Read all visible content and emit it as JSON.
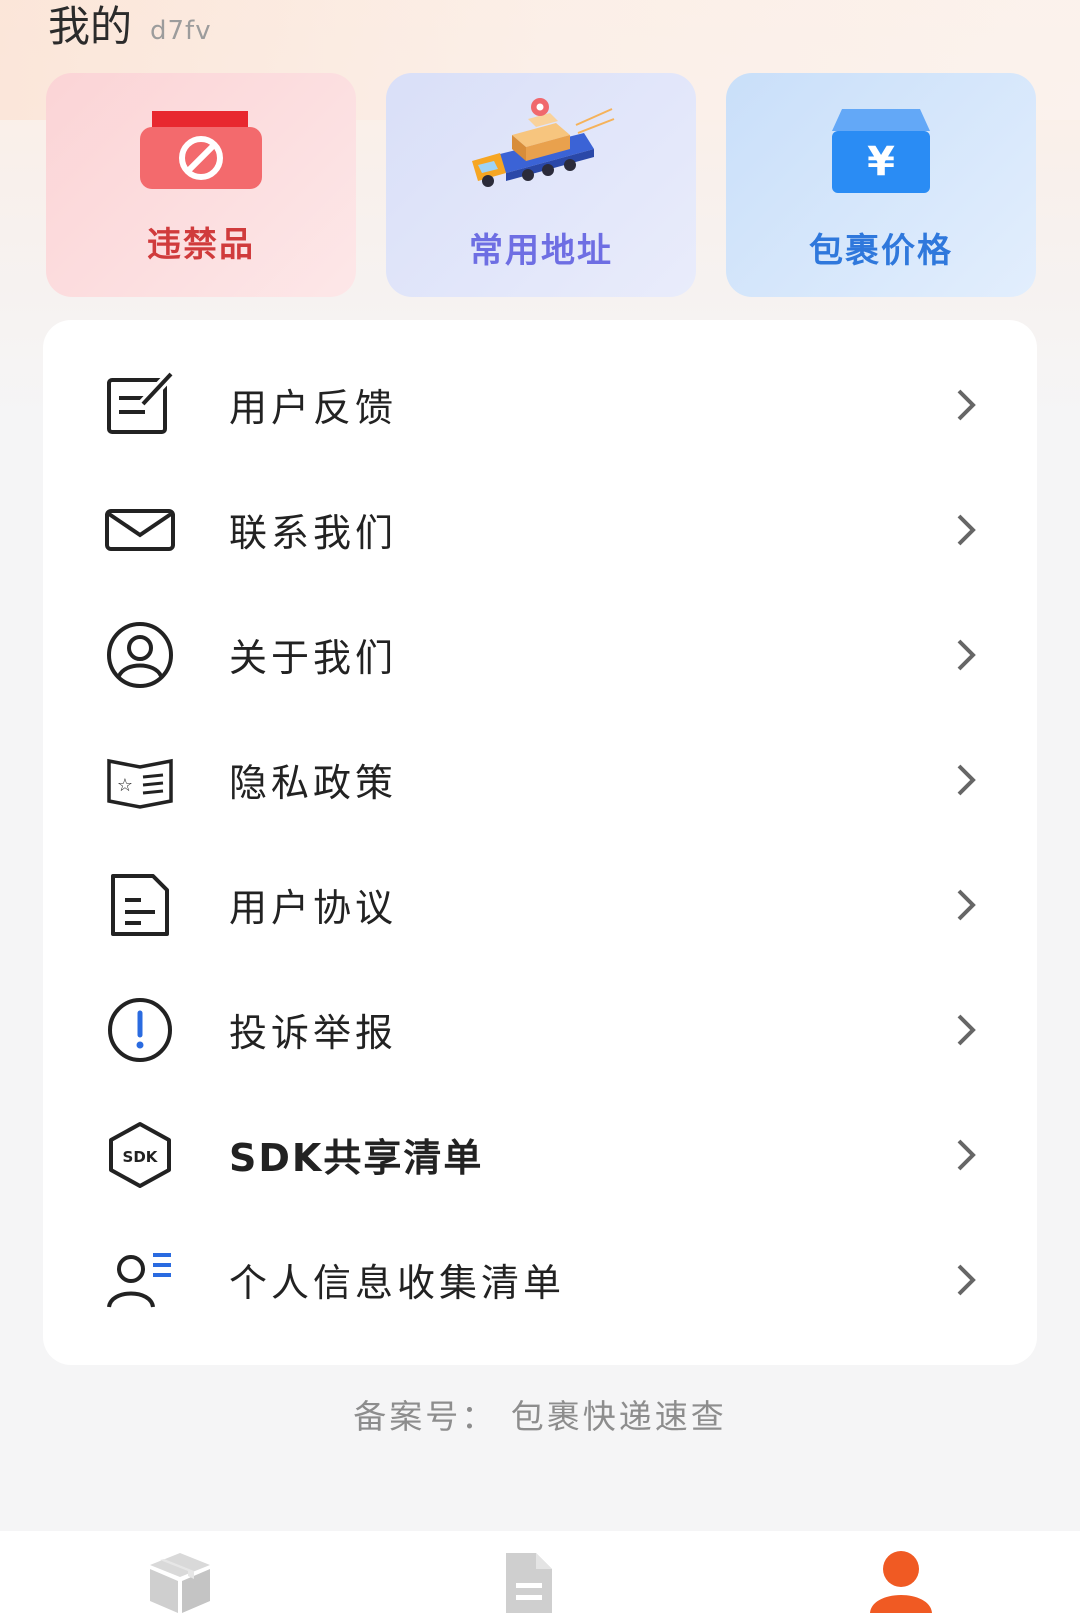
{
  "header": {
    "title": "我的",
    "subtitle": "d7fv"
  },
  "cards": [
    {
      "label": "违禁品",
      "icon": "prohibited-box-icon",
      "color": "#d03b3c"
    },
    {
      "label": "常用地址",
      "icon": "delivery-truck-icon",
      "color": "#6e6ee3"
    },
    {
      "label": "包裹价格",
      "icon": "yuan-box-icon",
      "color": "#2f78dc"
    }
  ],
  "menu": {
    "items": [
      {
        "label": "用户反馈",
        "icon": "feedback-edit-icon"
      },
      {
        "label": "联系我们",
        "icon": "mail-icon"
      },
      {
        "label": "关于我们",
        "icon": "user-circle-icon"
      },
      {
        "label": "隐私政策",
        "icon": "privacy-book-icon"
      },
      {
        "label": "用户协议",
        "icon": "document-icon"
      },
      {
        "label": "投诉举报",
        "icon": "alert-circle-icon"
      },
      {
        "label": "SDK共享清单",
        "icon": "sdk-icon"
      },
      {
        "label": "个人信息收集清单",
        "icon": "user-list-icon"
      }
    ]
  },
  "footer": {
    "filing": "备案号：  包裹快递速查"
  },
  "tabbar": {
    "tabs": [
      {
        "icon": "package-icon",
        "active": false
      },
      {
        "icon": "document-icon",
        "active": false
      },
      {
        "icon": "person-icon",
        "active": true
      }
    ],
    "active_color": "#f05a23",
    "inactive_color": "#cfcfcf"
  }
}
